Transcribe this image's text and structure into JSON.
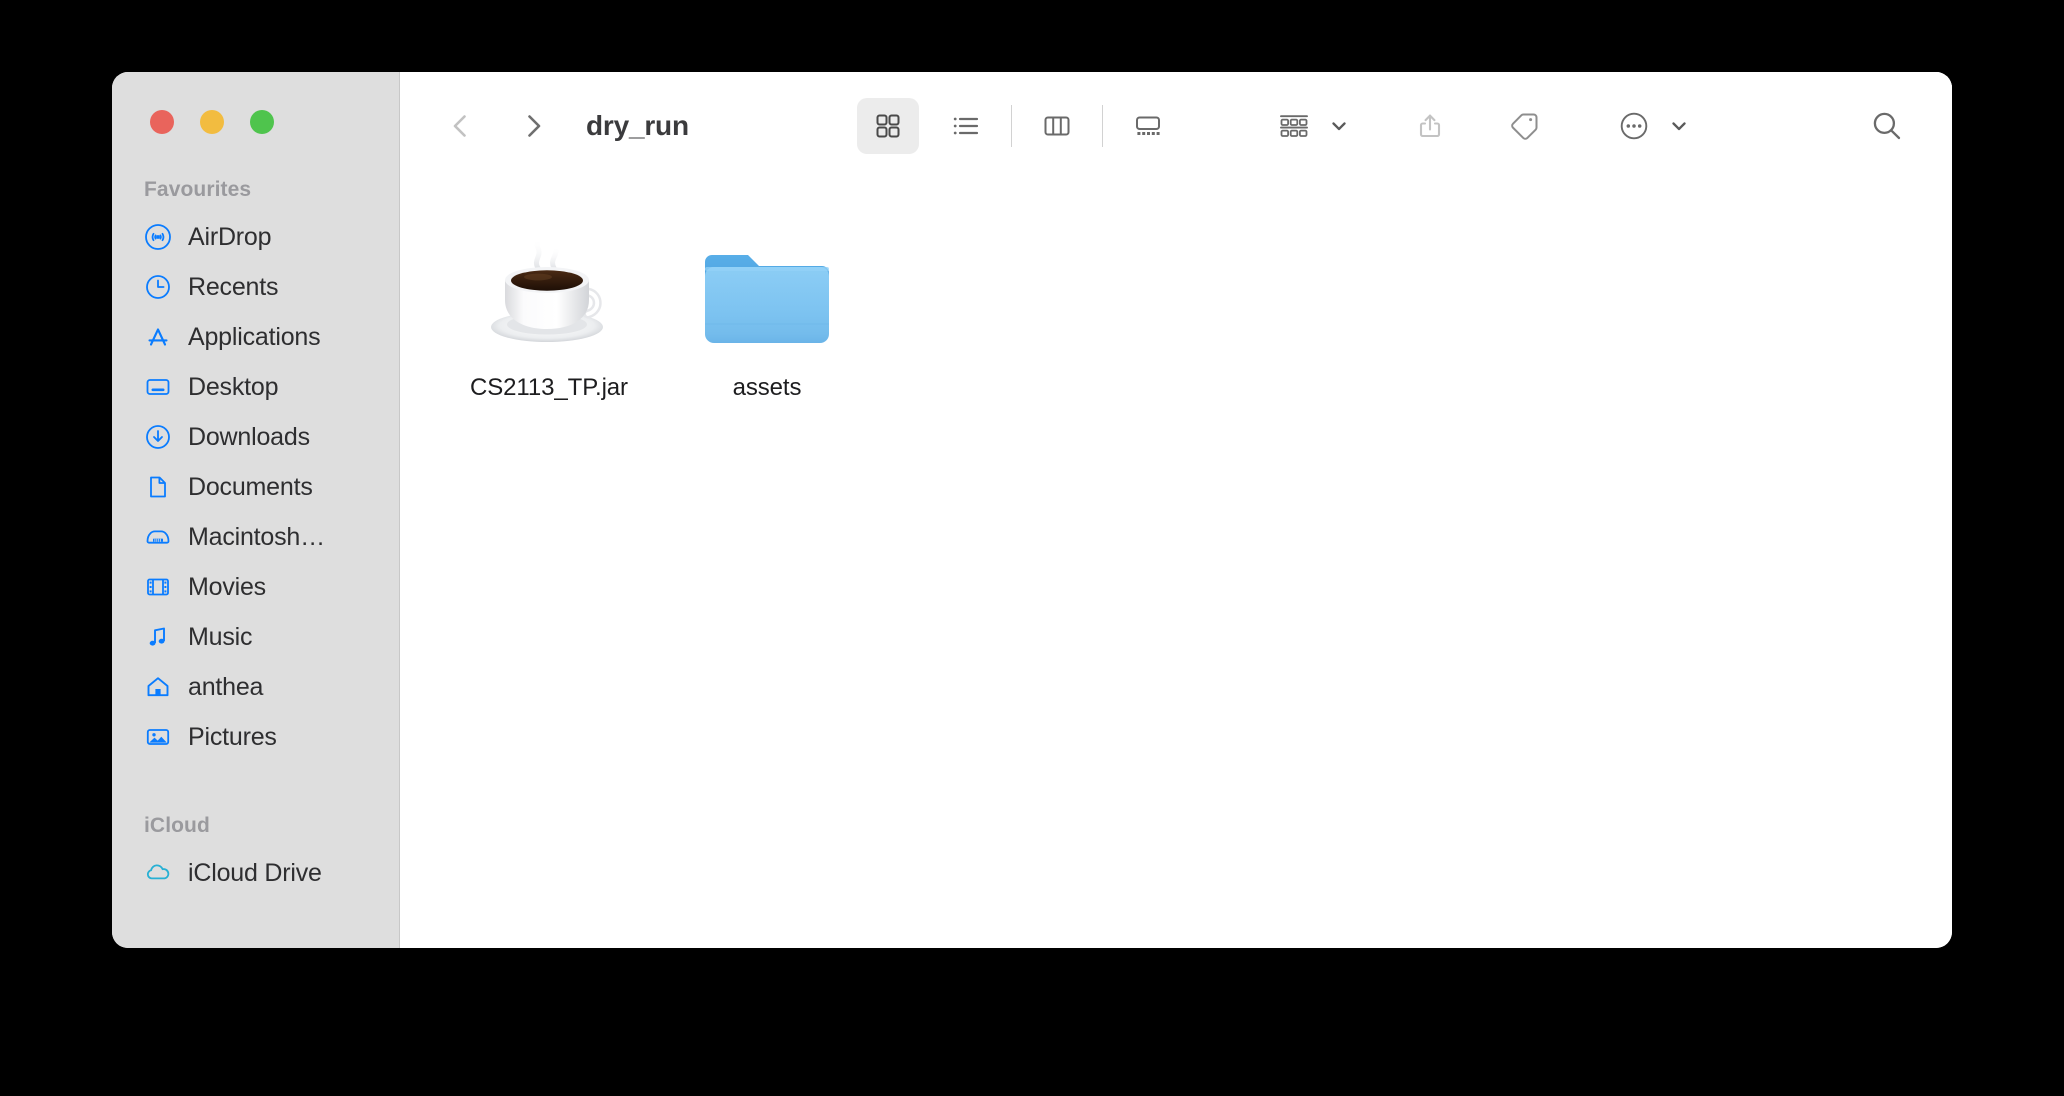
{
  "window": {
    "title": "dry_run",
    "traffic_lights": [
      {
        "name": "close",
        "color": "#e9645c"
      },
      {
        "name": "minimize",
        "color": "#f2bc40"
      },
      {
        "name": "maximize",
        "color": "#4fc44d"
      }
    ]
  },
  "toolbar": {
    "back_label": "Back",
    "forward_label": "Forward",
    "title": "dry_run",
    "view_modes": [
      {
        "id": "icon",
        "label": "Icon View",
        "icon": "grid-icon",
        "active": true
      },
      {
        "id": "list",
        "label": "List View",
        "icon": "list-icon",
        "active": false
      },
      {
        "id": "column",
        "label": "Column View",
        "icon": "column-icon",
        "active": false
      },
      {
        "id": "gallery",
        "label": "Gallery View",
        "icon": "gallery-icon",
        "active": false
      }
    ],
    "group_by_label": "Group By",
    "share_label": "Share",
    "tags_label": "Tags",
    "more_label": "More",
    "search_label": "Search"
  },
  "sidebar": {
    "sections": [
      {
        "title": "Favourites",
        "items": [
          {
            "label": "AirDrop",
            "icon": "airdrop-icon"
          },
          {
            "label": "Recents",
            "icon": "clock-icon"
          },
          {
            "label": "Applications",
            "icon": "applications-icon"
          },
          {
            "label": "Desktop",
            "icon": "desktop-icon"
          },
          {
            "label": "Downloads",
            "icon": "download-icon"
          },
          {
            "label": "Documents",
            "icon": "document-icon"
          },
          {
            "label": "Macintosh…",
            "icon": "harddisk-icon"
          },
          {
            "label": "Movies",
            "icon": "film-icon"
          },
          {
            "label": "Music",
            "icon": "music-note-icon"
          },
          {
            "label": "anthea",
            "icon": "home-icon"
          },
          {
            "label": "Pictures",
            "icon": "picture-icon"
          }
        ]
      },
      {
        "title": "iCloud",
        "items": [
          {
            "label": "iCloud Drive",
            "icon": "cloud-icon"
          }
        ]
      }
    ]
  },
  "files": [
    {
      "name": "CS2113_TP.jar",
      "kind": "jar",
      "icon": "coffee-cup-icon"
    },
    {
      "name": "assets",
      "kind": "folder",
      "icon": "folder-icon"
    }
  ],
  "colors": {
    "sidebar_bg": "#dedede",
    "accent_blue": "#0a7cff",
    "folder_blue": "#7ac6f2",
    "icloud_teal": "#27b0d4",
    "text_primary": "#1d1d1f",
    "text_secondary": "#9a9a9e"
  }
}
